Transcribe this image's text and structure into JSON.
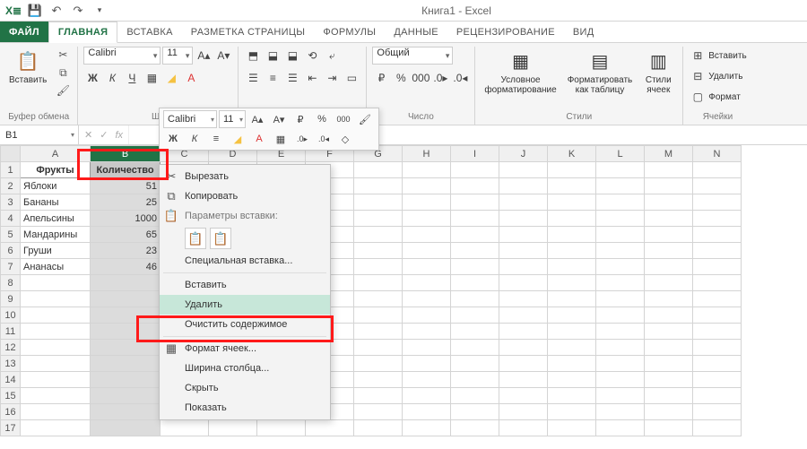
{
  "titlebar": {
    "title": "Книга1 - Excel"
  },
  "tabs": {
    "file": "ФАЙЛ",
    "items": [
      "ГЛАВНАЯ",
      "ВСТАВКА",
      "РАЗМЕТКА СТРАНИЦЫ",
      "ФОРМУЛЫ",
      "ДАННЫЕ",
      "РЕЦЕНЗИРОВАНИЕ",
      "ВИД"
    ],
    "active_index": 0
  },
  "ribbon": {
    "clipboard": {
      "label": "Буфер обмена",
      "paste": "Вставить"
    },
    "font": {
      "name": "Calibri",
      "size": "11",
      "label": "Шр"
    },
    "number": {
      "format": "Общий",
      "label": "Число"
    },
    "styles": {
      "cond": "Условное\nформатирование",
      "table": "Форматировать\nкак таблицу",
      "cell": "Стили\nячеек",
      "label": "Стили"
    },
    "cells": {
      "insert": "Вставить",
      "delete": "Удалить",
      "format": "Формат",
      "label": "Ячейки"
    }
  },
  "namebox": "B1",
  "columns": [
    "A",
    "B",
    "C",
    "D",
    "E",
    "F",
    "G",
    "H",
    "I",
    "J",
    "K",
    "L",
    "M",
    "N"
  ],
  "selected_column": "B",
  "rows": 17,
  "data": {
    "headers": [
      "Фрукты",
      "Количество"
    ],
    "rows": [
      [
        "Яблоки",
        "51"
      ],
      [
        "Бананы",
        "25"
      ],
      [
        "Апельсины",
        "1000"
      ],
      [
        "Мандарины",
        "65"
      ],
      [
        "Груши",
        "23"
      ],
      [
        "Ананасы",
        "46"
      ]
    ]
  },
  "mini_toolbar": {
    "font": "Calibri",
    "size": "11"
  },
  "context_menu": {
    "cut": "Вырезать",
    "copy": "Копировать",
    "paste_header": "Параметры вставки:",
    "paste_special": "Специальная вставка...",
    "insert": "Вставить",
    "delete": "Удалить",
    "clear": "Очистить содержимое",
    "format_cells": "Формат ячеек...",
    "col_width": "Ширина столбца...",
    "hide": "Скрыть",
    "show": "Показать"
  },
  "chart_data": {
    "type": "table",
    "title": "",
    "columns": [
      "Фрукты",
      "Количество"
    ],
    "rows": [
      [
        "Яблоки",
        51
      ],
      [
        "Бананы",
        25
      ],
      [
        "Апельсины",
        1000
      ],
      [
        "Мандарины",
        65
      ],
      [
        "Груши",
        23
      ],
      [
        "Ананасы",
        46
      ]
    ]
  }
}
